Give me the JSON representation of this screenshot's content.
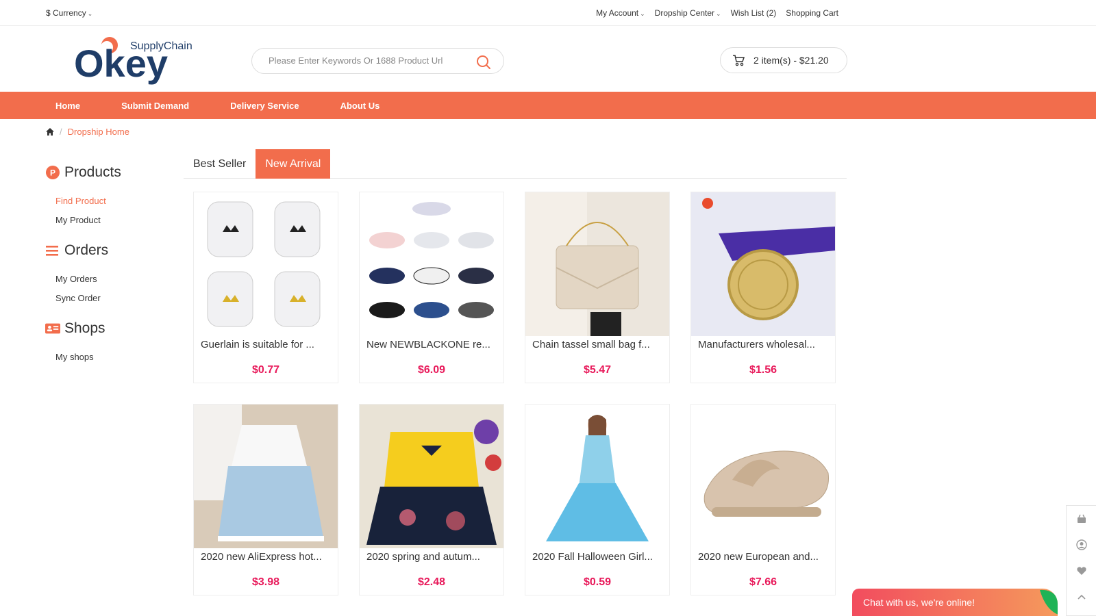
{
  "topbar": {
    "currency": "$ Currency",
    "links": [
      "My Account",
      "Dropship Center",
      "Wish List (2)",
      "Shopping Cart"
    ]
  },
  "logo": {
    "main": "Okey",
    "sub": "SupplyChain"
  },
  "search": {
    "placeholder": "Please Enter Keywords Or 1688 Product Url",
    "icon": "search-icon"
  },
  "cart": {
    "summary": "2 item(s) - $21.20",
    "icon": "cart-icon"
  },
  "nav": [
    "Home",
    "Submit Demand",
    "Delivery Service",
    "About Us"
  ],
  "breadcrumb": {
    "current": "Dropship Home",
    "icon": "home-icon"
  },
  "sidebar": {
    "products": {
      "title": "Products",
      "items": [
        "Find Product",
        "My Product"
      ]
    },
    "orders": {
      "title": "Orders",
      "items": [
        "My Orders",
        "Sync Order"
      ]
    },
    "shops": {
      "title": "Shops",
      "items": [
        "My shops"
      ]
    }
  },
  "tabs": [
    "Best Seller",
    "New Arrival"
  ],
  "products": [
    {
      "title": "Guerlain is suitable for ...",
      "price": "$0.77"
    },
    {
      "title": "New NEWBLACKONE re...",
      "price": "$6.09"
    },
    {
      "title": "Chain tassel small bag f...",
      "price": "$5.47"
    },
    {
      "title": "Manufacturers wholesal...",
      "price": "$1.56"
    },
    {
      "title": "2020 new AliExpress hot...",
      "price": "$3.98"
    },
    {
      "title": "2020 spring and autum...",
      "price": "$2.48"
    },
    {
      "title": "2020 Fall Halloween Girl...",
      "price": "$0.59"
    },
    {
      "title": "2020 new European and...",
      "price": "$7.66"
    }
  ],
  "chat": {
    "label": "Chat with us, we're online!"
  },
  "colors": {
    "accent": "#f26d4c",
    "price": "#e8195a"
  }
}
